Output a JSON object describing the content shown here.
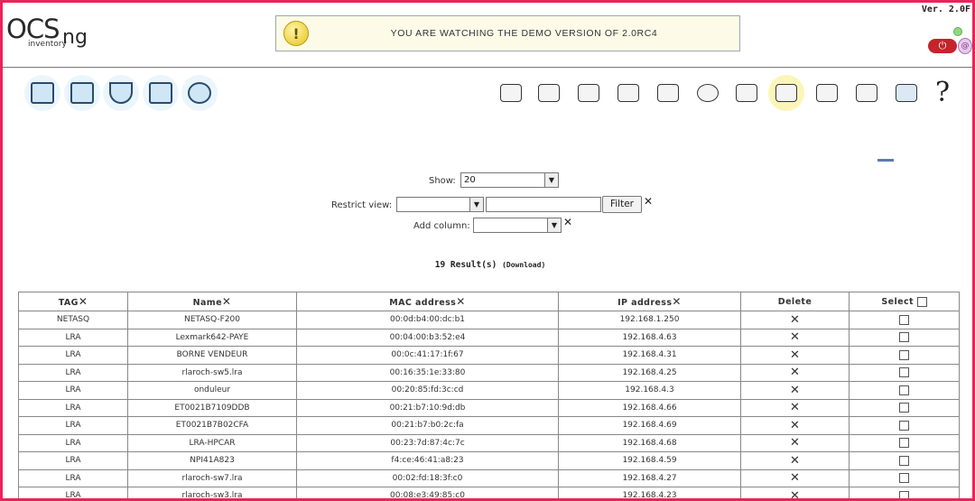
{
  "header": {
    "logo_main": "OCS",
    "logo_suffix": "ng",
    "logo_sub": "inventory",
    "banner_message": "YOU ARE WATCHING THE DEMO VERSION OF 2.0RC4",
    "version": "Ver. 2.0F"
  },
  "form": {
    "show_label": "Show:",
    "show_value": "20",
    "restrict_label": "Restrict view:",
    "filter_button": "Filter",
    "add_column_label": "Add column:"
  },
  "results": {
    "count_text": "19 Result(s)",
    "download_text": "(Download)"
  },
  "table": {
    "headers": [
      "TAG",
      "Name",
      "MAC address",
      "IP address",
      "Delete",
      "Select"
    ],
    "rows": [
      [
        "NETASQ",
        "NETASQ-F200",
        "00:0d:b4:00:dc:b1",
        "192.168.1.250"
      ],
      [
        "LRA",
        "Lexmark642-PAYE",
        "00:04:00:b3:52:e4",
        "192.168.4.63"
      ],
      [
        "LRA",
        "BORNE VENDEUR",
        "00:0c:41:17:1f:67",
        "192.168.4.31"
      ],
      [
        "LRA",
        "rlaroch-sw5.lra",
        "00:16:35:1e:33:80",
        "192.168.4.25"
      ],
      [
        "LRA",
        "onduleur",
        "00:20:85:fd:3c:cd",
        "192.168.4.3"
      ],
      [
        "LRA",
        "ET0021B7109DDB",
        "00:21:b7:10:9d:db",
        "192.168.4.66"
      ],
      [
        "LRA",
        "ET0021B7B02CFA",
        "00:21:b7:b0:2c:fa",
        "192.168.4.69"
      ],
      [
        "LRA",
        "LRA-HPCAR",
        "00:23:7d:87:4c:7c",
        "192.168.4.68"
      ],
      [
        "LRA",
        "NPI41A823",
        "f4:ce:46:41:a8:23",
        "192.168.4.59"
      ],
      [
        "LRA",
        "rlaroch-sw7.lra",
        "00:02:fd:18:3f:c0",
        "192.168.4.27"
      ],
      [
        "LRA",
        "rlaroch-sw3.lra",
        "00:08:e3:49:85:c0",
        "192.168.4.23"
      ]
    ]
  },
  "icons": {
    "left": [
      "computers-icon",
      "network-icon",
      "filter-icon",
      "groups-icon",
      "search-icon"
    ],
    "right": [
      "deploy-icon",
      "plane-icon",
      "tools-icon",
      "calculator-icon",
      "book-icon",
      "chart-icon",
      "registry-icon",
      "network-scan-icon",
      "card-icon",
      "admin-icon",
      "back-icon",
      "help-icon"
    ]
  },
  "colors": {
    "frame": "#e8245a",
    "logout": "#c4242b",
    "status": "#8ddc7c"
  }
}
